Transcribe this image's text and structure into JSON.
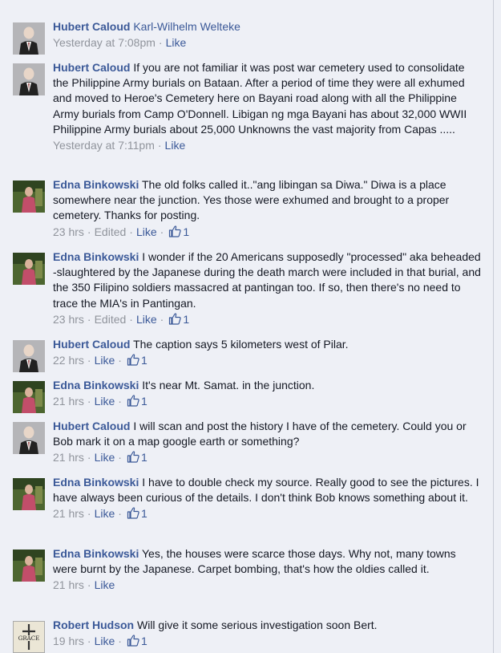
{
  "comments": [
    {
      "author": "Hubert Caloud",
      "avatar": "hubert",
      "tag": "Karl-Wilhelm Welteke",
      "text": "",
      "time": "Yesterday at 7:08pm",
      "edited": "",
      "like_label": "Like",
      "likes": ""
    },
    {
      "author": "Hubert Caloud",
      "avatar": "hubert",
      "tag": "",
      "text": "If you are not familiar it was post war cemetery used to consolidate the Philippine Army burials on Bataan. After a period of time they were all exhumed and moved to Heroe's Cemetery here on Bayani road along with all the Philippine Army burials from Camp O'Donnell. Libigan ng mga Bayani has about 32,000 WWII Philippine Army burials about 25,000 Unknowns the vast majority from Capas .....",
      "time": "Yesterday at 7:11pm",
      "edited": "",
      "like_label": "Like",
      "likes": ""
    },
    {
      "author": "Edna Binkowski",
      "avatar": "edna",
      "tag": "",
      "text": "The old folks called it..\"ang libingan sa Diwa.\" Diwa is a place somewhere near the junction. Yes those were exhumed and brought to a proper cemetery. Thanks for posting.",
      "time": "23 hrs",
      "edited": "Edited",
      "like_label": "Like",
      "likes": "1"
    },
    {
      "author": "Edna Binkowski",
      "avatar": "edna",
      "tag": "",
      "text": "I wonder if the 20 Americans supposedly \"processed\" aka beheaded -slaughtered by the Japanese during the death march were included in that burial, and the 350 Filipino soldiers massacred at pantingan too. If so, then there's no need to trace the MIA's in Pantingan.",
      "time": "23 hrs",
      "edited": "Edited",
      "like_label": "Like",
      "likes": "1"
    },
    {
      "author": "Hubert Caloud",
      "avatar": "hubert",
      "tag": "",
      "text": "The caption says 5 kilometers west of Pilar.",
      "time": "22 hrs",
      "edited": "",
      "like_label": "Like",
      "likes": "1"
    },
    {
      "author": "Edna Binkowski",
      "avatar": "edna",
      "tag": "",
      "text": "It's near Mt. Samat. in the junction.",
      "time": "21 hrs",
      "edited": "",
      "like_label": "Like",
      "likes": "1"
    },
    {
      "author": "Hubert Caloud",
      "avatar": "hubert",
      "tag": "",
      "text": "I will scan and post the history I have of the cemetery. Could you or Bob mark it on a map google earth or something?",
      "time": "21 hrs",
      "edited": "",
      "like_label": "Like",
      "likes": "1"
    },
    {
      "author": "Edna Binkowski",
      "avatar": "edna",
      "tag": "",
      "text": "I have to double check my source. Really good to see the pictures. I have always been curious of the details. I don't think Bob knows something about it.",
      "time": "21 hrs",
      "edited": "",
      "like_label": "Like",
      "likes": "1"
    },
    {
      "author": "Edna Binkowski",
      "avatar": "edna",
      "tag": "",
      "text": "Yes, the houses were scarce those days. Why not, many towns were burnt by the Japanese. Carpet bombing, that's how the oldies called it.",
      "time": "21 hrs",
      "edited": "",
      "like_label": "Like",
      "likes": ""
    },
    {
      "author": "Robert Hudson",
      "avatar": "robert",
      "tag": "",
      "text": "Will give it some serious investigation soon Bert.",
      "time": "19 hrs",
      "edited": "",
      "like_label": "Like",
      "likes": "1"
    }
  ],
  "colors": {
    "link": "#3b5998",
    "meta": "#90949c",
    "text": "#141823",
    "background": "#eef0f6"
  },
  "icons": {
    "like_count": "thumbs-up-icon"
  }
}
